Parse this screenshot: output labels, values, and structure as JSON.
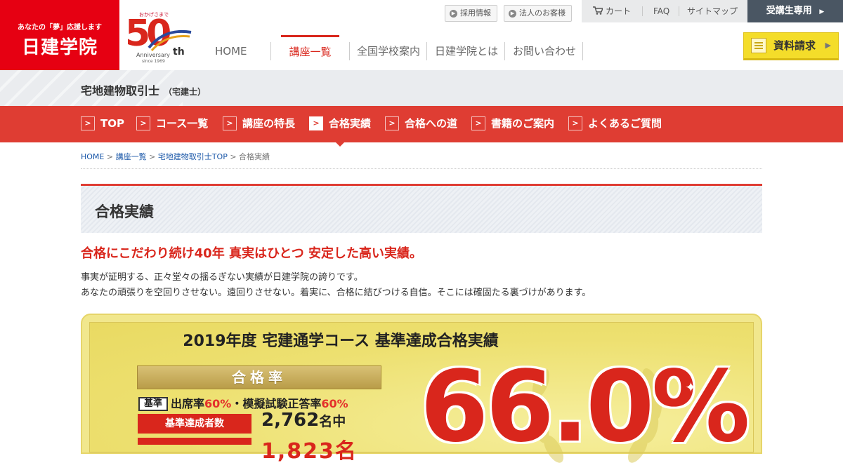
{
  "brand": {
    "tagline": "あなたの「夢」応援します",
    "name": "日建学院",
    "anniversary": {
      "top": "おかげさまで",
      "number": "50",
      "label": "Anniversary",
      "suffix": "th",
      "since": "since 1969"
    }
  },
  "utility": {
    "recruit": "採用情報",
    "corporate": "法人のお客様",
    "cart": "カート",
    "faq": "FAQ",
    "sitemap": "サイトマップ",
    "member": "受講生専用"
  },
  "global_nav": {
    "items": [
      "HOME",
      "講座一覧",
      "全国学校案内",
      "日建学院とは",
      "お問い合わせ"
    ],
    "active": "講座一覧"
  },
  "doc_request": "資料請求",
  "course": {
    "title": "宅地建物取引士",
    "short": "（宅建士）"
  },
  "sub_nav": {
    "items": [
      "TOP",
      "コース一覧",
      "講座の特長",
      "合格実績",
      "合格への道",
      "書籍のご案内",
      "よくあるご質問"
    ],
    "active": "合格実績"
  },
  "breadcrumb": {
    "items": [
      "HOME",
      "講座一覧",
      "宅地建物取引士TOP"
    ],
    "current": "合格実績",
    "separator": ">"
  },
  "page": {
    "title": "合格実績",
    "lead": "合格にこだわり続け40年 真実はひとつ 安定した高い実績。",
    "body_lines": [
      "事実が証明する、正々堂々の揺るぎない実績が日建学院の誇りです。",
      "あなたの頑張りを空回りさせない。遠回りさせない。着実に、合格に結びつける自信。そこには確固たる裏づけがあります。"
    ]
  },
  "results": {
    "title": "2019年度 宅建通学コース 基準達成合格実績",
    "rate_banner": "合格率",
    "criteria_tag": "基準",
    "criteria_a_label": "出席率",
    "criteria_a_value": "60%",
    "criteria_join": "・",
    "criteria_b_label": "模擬試験正答率",
    "criteria_b_value": "60%",
    "achievers_label": "基準達成者数",
    "achievers_value": "2,762",
    "achievers_unit": "名中",
    "passers_value": "1,823名",
    "rate_value": "66.0%"
  },
  "colors": {
    "brand_red": "#e60012",
    "subnav_red": "#df3d33",
    "accent_yellow": "#f4dd2a",
    "member_dark": "#4a5663"
  }
}
